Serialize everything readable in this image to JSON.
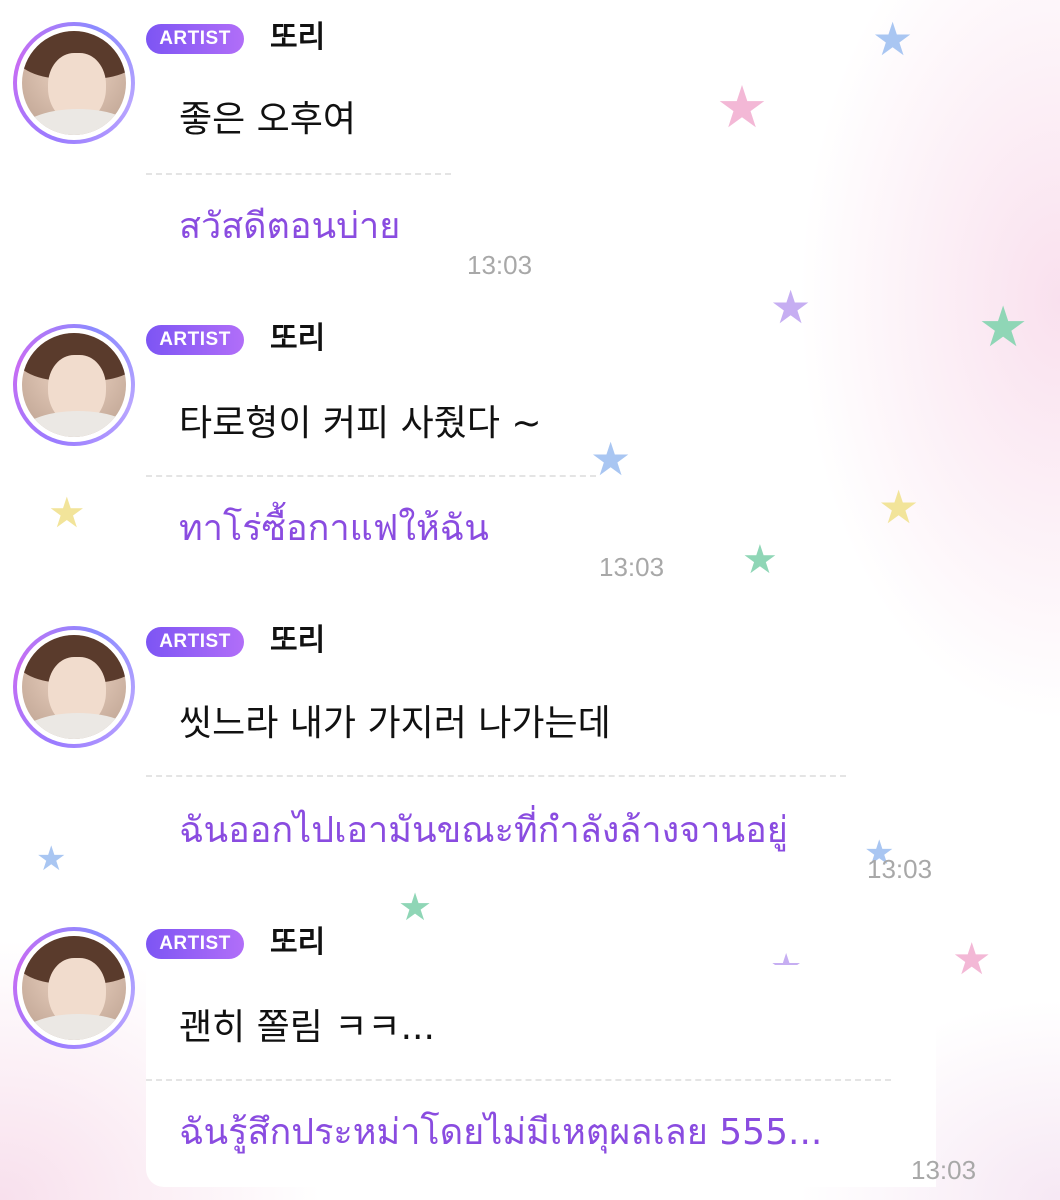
{
  "messages": [
    {
      "badge": "ARTIST",
      "name": "또리",
      "original": "좋은 오후여",
      "translation": "สวัสดีตอนบ่าย",
      "time": "13:03"
    },
    {
      "badge": "ARTIST",
      "name": "또리",
      "original": "타로형이 커피 사줬다 ~",
      "translation": "ทาโร่ซื้อกาแฟให้ฉัน",
      "time": "13:03"
    },
    {
      "badge": "ARTIST",
      "name": "또리",
      "original": "씻느라 내가 가지러 나가는데",
      "translation": "ฉันออกไปเอามันขณะที่กำลังล้างจานอยู่",
      "time": "13:03"
    },
    {
      "badge": "ARTIST",
      "name": "또리",
      "original": "괜히 쫄림 ㅋㅋ...",
      "translation": "ฉันรู้สึกประหม่าโดยไม่มีเหตุผลเลย 555...",
      "time": "13:03"
    }
  ],
  "decor": {
    "star_icon": "star-icon",
    "star_colors": {
      "blue": "#a9c6f2",
      "pink": "#f3b8d6",
      "purple": "#c6aef2",
      "green": "#8fd6b6",
      "yellow": "#f2e49a"
    }
  }
}
